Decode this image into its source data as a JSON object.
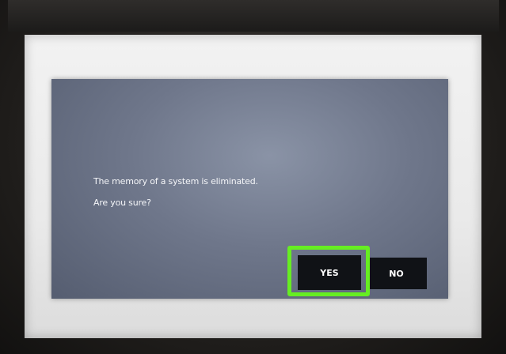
{
  "dialog": {
    "message_line1": "The memory of a system is eliminated.",
    "message_line2": "Are you sure?",
    "yes_label": "YES",
    "no_label": "NO"
  },
  "colors": {
    "dialog_bg": "#6f778b",
    "button_bg": "#101216",
    "highlight": "#66ee22",
    "screen_bg": "#eaeaea"
  }
}
